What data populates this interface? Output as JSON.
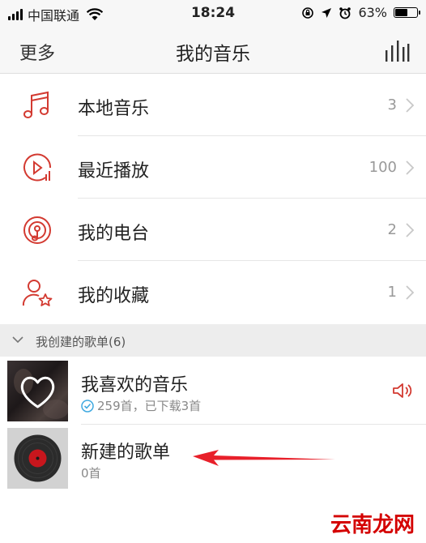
{
  "status_bar": {
    "carrier": "中国联通",
    "time": "18:24",
    "battery_percent": "63%",
    "battery_level": 0.63
  },
  "nav": {
    "left_label": "更多",
    "title": "我的音乐",
    "right_icon": "equalizer-bars-icon"
  },
  "menu": [
    {
      "label": "本地音乐",
      "count": "3",
      "icon": "music-note-icon"
    },
    {
      "label": "最近播放",
      "count": "100",
      "icon": "recent-play-icon"
    },
    {
      "label": "我的电台",
      "count": "2",
      "icon": "radio-icon"
    },
    {
      "label": "我的收藏",
      "count": "1",
      "icon": "favorite-user-star-icon"
    }
  ],
  "section": {
    "title": "我创建的歌单(6)"
  },
  "playlists": [
    {
      "title": "我喜欢的音乐",
      "subtitle": "259首，已下载3首",
      "cover_icon": "heart-icon"
    },
    {
      "title": "新建的歌单",
      "subtitle": "0首",
      "cover_icon": "vinyl-record-icon"
    }
  ],
  "colors": {
    "accent_red": "#d33a31",
    "annotation_arrow": "#e8202a",
    "check_blue": "#3fa9e0"
  },
  "watermark": "云南龙网"
}
